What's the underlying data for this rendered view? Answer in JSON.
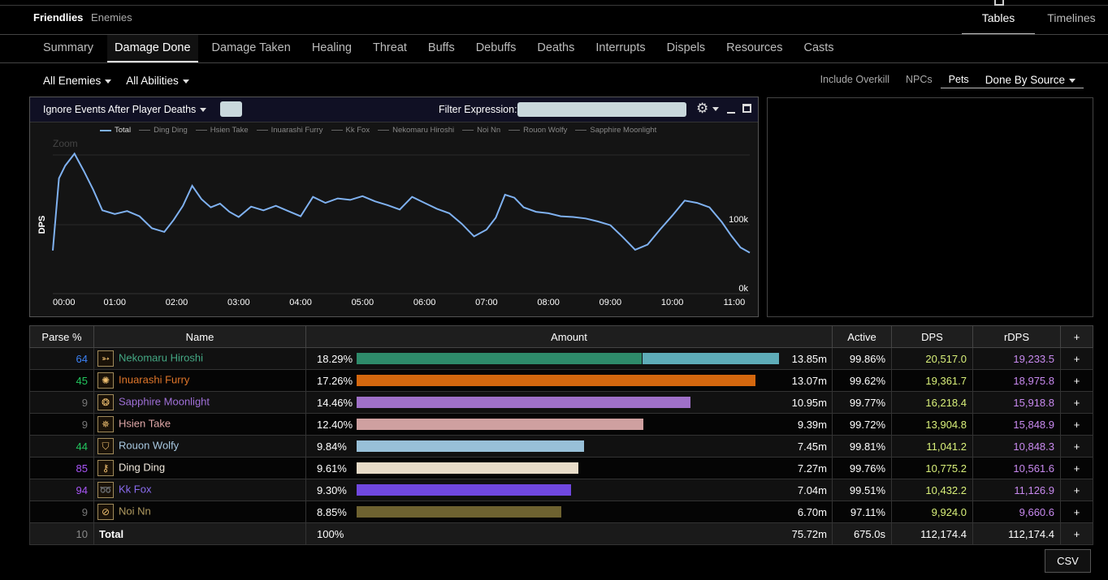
{
  "top": {
    "friendlies": "Friendlies",
    "enemies": "Enemies",
    "tables": "Tables",
    "timelines": "Timelines"
  },
  "tabs": [
    "Summary",
    "Damage Done",
    "Damage Taken",
    "Healing",
    "Threat",
    "Buffs",
    "Debuffs",
    "Deaths",
    "Interrupts",
    "Dispels",
    "Resources",
    "Casts"
  ],
  "filters": {
    "enemies": "All Enemies",
    "abilities": "All Abilities",
    "include_overkill": "Include Overkill",
    "npcs": "NPCs",
    "pets": "Pets",
    "done_by": "Done By Source"
  },
  "chart_header": {
    "dropdown": "Ignore Events After Player Deaths",
    "filter_label": "Filter Expression:"
  },
  "chart_data": {
    "type": "line",
    "ylabel": "DPS",
    "zoom_label": "Zoom",
    "y_ticks": [
      "100k",
      "0k"
    ],
    "x_ticks": [
      "00:00",
      "01:00",
      "02:00",
      "03:00",
      "04:00",
      "05:00",
      "06:00",
      "07:00",
      "08:00",
      "09:00",
      "10:00",
      "11:00"
    ],
    "legend": [
      "Total",
      "Ding Ding",
      "Hsien Take",
      "Inuarashi Furry",
      "Kk Fox",
      "Nekomaru Hiroshi",
      "Noi Nn",
      "Rouon Wolfy",
      "Sapphire Moonlight"
    ],
    "series": [
      {
        "name": "Total",
        "color": "#7fb1f0",
        "x_minutes": [
          0,
          0.1,
          0.2,
          0.35,
          0.5,
          0.65,
          0.8,
          1.0,
          1.2,
          1.4,
          1.6,
          1.8,
          1.95,
          2.1,
          2.25,
          2.4,
          2.55,
          2.7,
          2.85,
          3.0,
          3.2,
          3.4,
          3.6,
          3.8,
          4.0,
          4.2,
          4.4,
          4.6,
          4.8,
          5.0,
          5.2,
          5.4,
          5.6,
          5.8,
          6.0,
          6.2,
          6.4,
          6.6,
          6.8,
          7.0,
          7.15,
          7.3,
          7.45,
          7.6,
          7.8,
          8.0,
          8.2,
          8.4,
          8.6,
          8.8,
          9.0,
          9.2,
          9.4,
          9.6,
          9.8,
          10.0,
          10.2,
          10.4,
          10.6,
          10.8,
          10.95,
          11.1,
          11.25
        ],
        "values": [
          58000,
          155000,
          172000,
          188000,
          165000,
          140000,
          112000,
          107000,
          111000,
          104000,
          88000,
          83000,
          99000,
          118000,
          145000,
          127000,
          116000,
          121000,
          110000,
          103000,
          117000,
          112000,
          118000,
          111000,
          104000,
          130000,
          122000,
          128000,
          126000,
          131000,
          124000,
          119000,
          113000,
          130000,
          122000,
          114000,
          108000,
          94000,
          77000,
          86000,
          102000,
          133000,
          129000,
          116000,
          110000,
          108000,
          104000,
          103000,
          101000,
          97000,
          92000,
          76000,
          59000,
          66000,
          86000,
          105000,
          125000,
          122000,
          116000,
          96000,
          78000,
          62000,
          55000
        ]
      }
    ],
    "ylim": [
      0,
      230000
    ],
    "xlim": [
      0,
      11.25
    ]
  },
  "table": {
    "headers": [
      "Parse %",
      "Name",
      "Amount",
      "Active",
      "DPS",
      "rDPS",
      "+"
    ],
    "rows": [
      {
        "parse": "64",
        "parse_color": "#3b82f6",
        "name": "Nekomaru Hiroshi",
        "name_color": "#44a884",
        "icon": "nekomaru-class-icon",
        "pct": "18.29%",
        "amount_fraction": 1.0,
        "split_fraction": 0.675,
        "bar_color": "#2e8b6a",
        "bar_color2": "#5eacb8",
        "amount": "13.85m",
        "active": "99.86%",
        "dps": "20,517.0",
        "rdps": "19,233.5"
      },
      {
        "parse": "45",
        "parse_color": "#22c55e",
        "name": "Inuarashi Furry",
        "name_color": "#e0762a",
        "icon": "inuarashi-class-icon",
        "pct": "17.26%",
        "amount_fraction": 0.944,
        "split_fraction": 1.0,
        "bar_color": "#d4670e",
        "bar_color2": "#d4670e",
        "amount": "13.07m",
        "active": "99.62%",
        "dps": "19,361.7",
        "rdps": "18,975.8"
      },
      {
        "parse": "9",
        "parse_color": "#777777",
        "name": "Sapphire Moonlight",
        "name_color": "#a070d8",
        "icon": "sapphire-class-icon",
        "pct": "14.46%",
        "amount_fraction": 0.791,
        "split_fraction": 1.0,
        "bar_color": "#9f70c8",
        "bar_color2": "#9f70c8",
        "amount": "10.95m",
        "active": "99.77%",
        "dps": "16,218.4",
        "rdps": "15,918.8"
      },
      {
        "parse": "9",
        "parse_color": "#777777",
        "name": "Hsien Take",
        "name_color": "#e0a8a8",
        "icon": "hsien-class-icon",
        "pct": "12.40%",
        "amount_fraction": 0.678,
        "split_fraction": 1.0,
        "bar_color": "#cfa0a0",
        "bar_color2": "#cfa0a0",
        "amount": "9.39m",
        "active": "99.72%",
        "dps": "13,904.8",
        "rdps": "15,848.9"
      },
      {
        "parse": "44",
        "parse_color": "#22c55e",
        "name": "Rouon Wolfy",
        "name_color": "#a8c8e0",
        "icon": "rouon-class-icon",
        "pct": "9.84%",
        "amount_fraction": 0.538,
        "split_fraction": 1.0,
        "bar_color": "#98c0d8",
        "bar_color2": "#98c0d8",
        "amount": "7.45m",
        "active": "99.81%",
        "dps": "11,041.2",
        "rdps": "10,848.3"
      },
      {
        "parse": "85",
        "parse_color": "#a855f7",
        "name": "Ding Ding",
        "name_color": "#f0e8dc",
        "icon": "ding-class-icon",
        "pct": "9.61%",
        "amount_fraction": 0.525,
        "split_fraction": 1.0,
        "bar_color": "#e8dcc8",
        "bar_color2": "#e8dcc8",
        "amount": "7.27m",
        "active": "99.76%",
        "dps": "10,775.2",
        "rdps": "10,561.6"
      },
      {
        "parse": "94",
        "parse_color": "#a855f7",
        "name": "Kk Fox",
        "name_color": "#8b6cf0",
        "icon": "kkfox-class-icon",
        "pct": "9.30%",
        "amount_fraction": 0.508,
        "split_fraction": 1.0,
        "bar_color": "#7048e0",
        "bar_color2": "#7048e0",
        "amount": "7.04m",
        "active": "99.51%",
        "dps": "10,432.2",
        "rdps": "11,126.9"
      },
      {
        "parse": "9",
        "parse_color": "#777777",
        "name": "Noi Nn",
        "name_color": "#b09a60",
        "icon": "noinn-class-icon",
        "pct": "8.85%",
        "amount_fraction": 0.484,
        "split_fraction": 1.0,
        "bar_color": "#6e6230",
        "bar_color2": "#6e6230",
        "amount": "6.70m",
        "active": "97.11%",
        "dps": "9,924.0",
        "rdps": "9,660.6"
      }
    ],
    "total": {
      "parse": "10",
      "name": "Total",
      "pct": "100%",
      "amount": "75.72m",
      "active": "675.0s",
      "dps": "112,174.4",
      "rdps": "112,174.4",
      "plus": "+"
    },
    "plus": "+"
  },
  "csv_label": "CSV"
}
